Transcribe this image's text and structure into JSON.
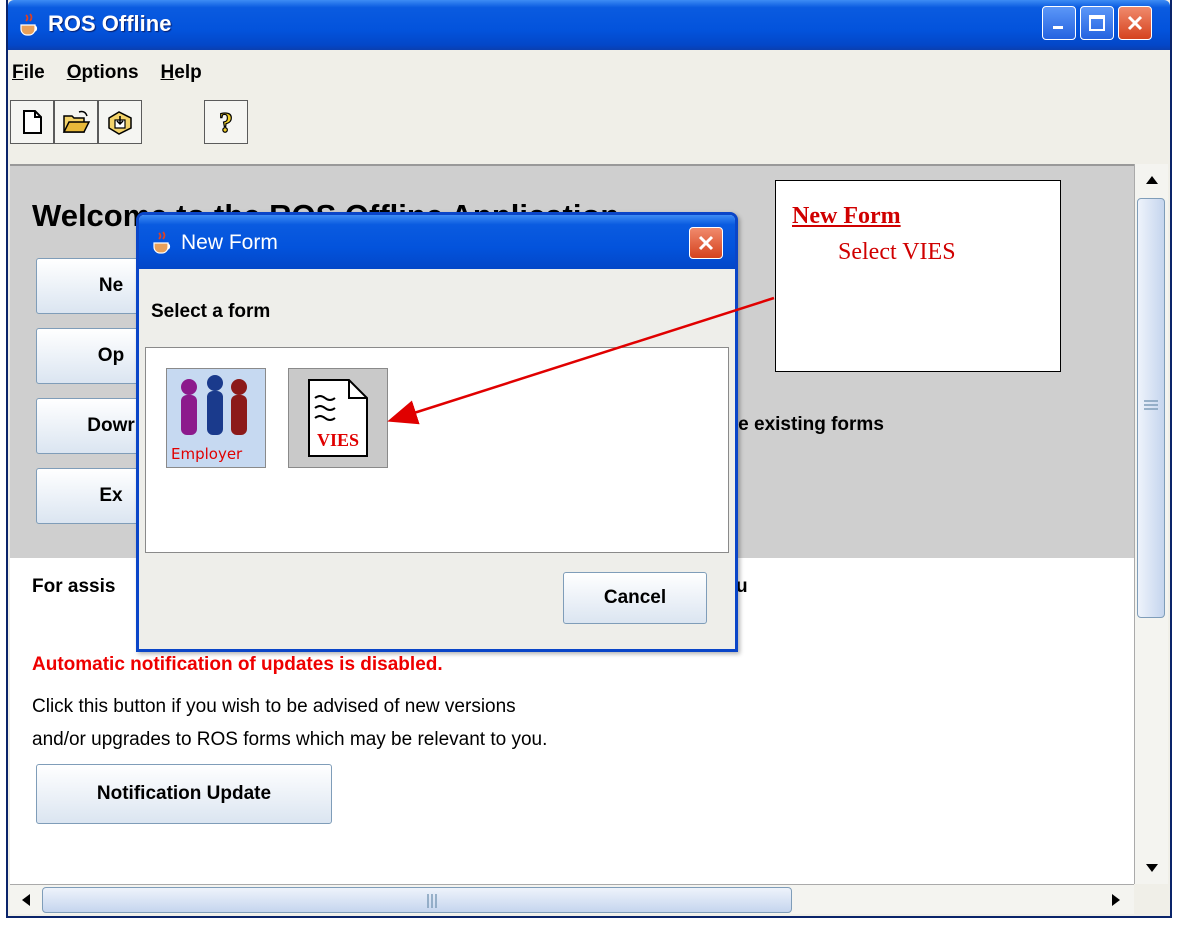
{
  "window": {
    "title": "ROS Offline"
  },
  "menu": {
    "items": [
      "File",
      "Options",
      "Help"
    ]
  },
  "main": {
    "welcome": "Welcome to the ROS Offline Application",
    "buttons": [
      "Ne",
      "Op",
      "Dowr",
      "Ex"
    ],
    "download_desc": "ade existing forms",
    "assist": "For assis",
    "assist_tail": "u",
    "notice": "Automatic notification of updates is disabled.",
    "line1": "Click this button if you wish to be advised of new versions",
    "line2": "and/or upgrades to ROS forms which may be relevant to you.",
    "notification_button": "Notification Update"
  },
  "dialog": {
    "title": "New Form",
    "prompt": "Select a form",
    "forms": [
      {
        "label": "Employer"
      },
      {
        "label": "VIES"
      }
    ],
    "cancel": "Cancel"
  },
  "callout": {
    "title": "New Form",
    "subtitle": "Select VIES"
  },
  "colors": {
    "titlebar": "#0353dc",
    "accent_red": "#d00000",
    "notice_red": "#ee0000"
  },
  "icons": [
    "java-cup-icon",
    "new-document-icon",
    "open-folder-icon",
    "save-form-icon",
    "help-icon",
    "minimize-icon",
    "maximize-icon",
    "close-icon"
  ]
}
